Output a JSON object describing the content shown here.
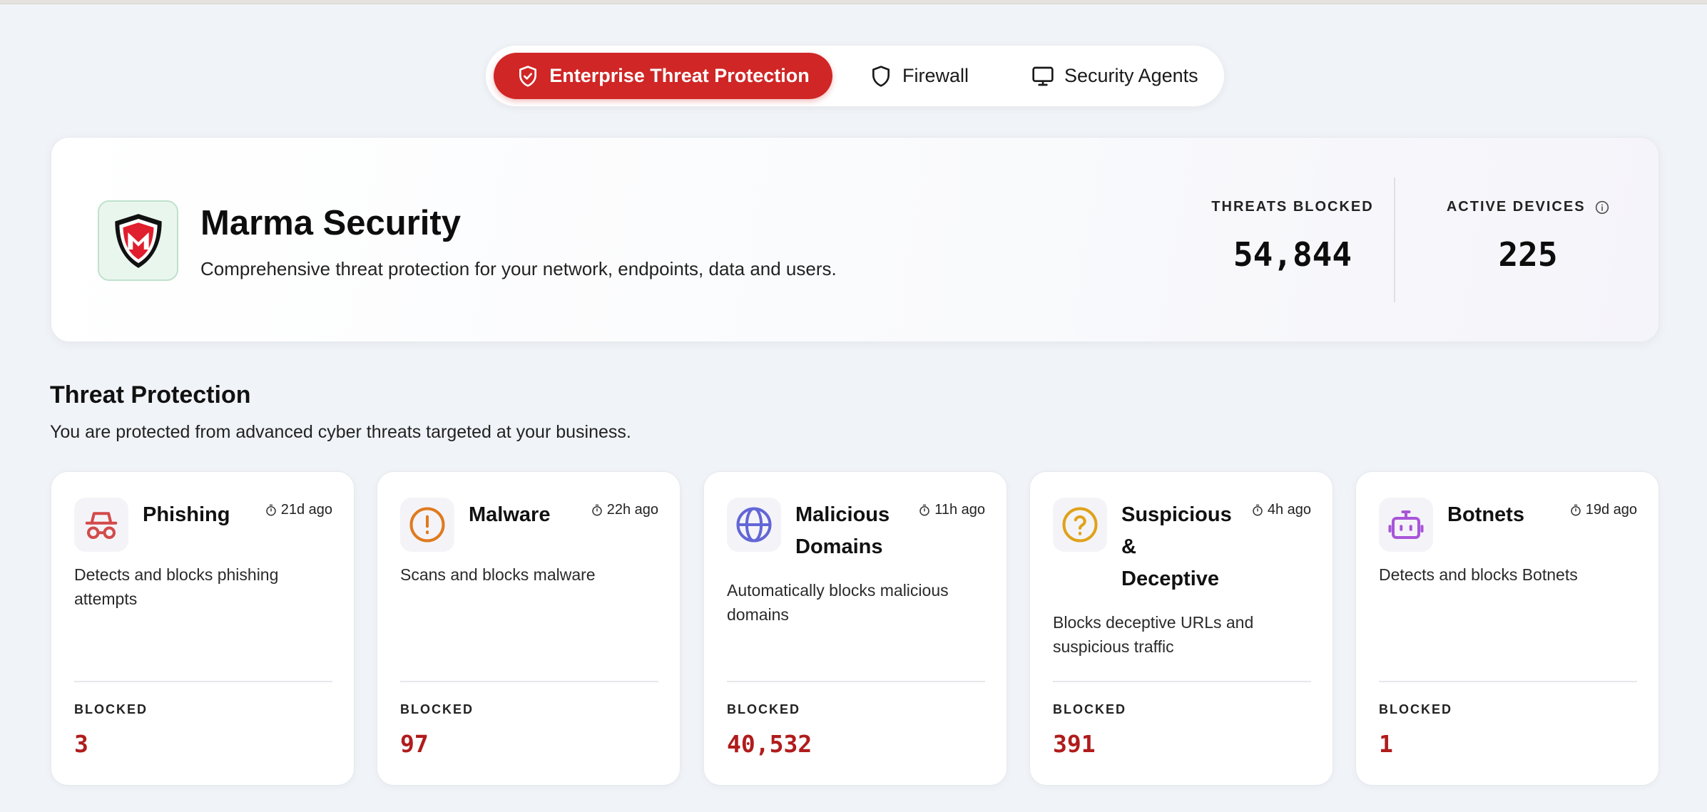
{
  "tabs": [
    {
      "label": "Enterprise Threat Protection",
      "icon": "shield-check-icon",
      "active": true
    },
    {
      "label": "Firewall",
      "icon": "shield-icon",
      "active": false
    },
    {
      "label": "Security Agents",
      "icon": "monitor-icon",
      "active": false
    }
  ],
  "hero": {
    "title": "Marma Security",
    "subtitle": "Comprehensive threat protection for your network, endpoints, data and users.",
    "logo_icon": "m-shield-logo",
    "stats": [
      {
        "label": "THREATS BLOCKED",
        "value": "54,844"
      },
      {
        "label": "ACTIVE DEVICES",
        "value": "225",
        "icon": "info-icon"
      }
    ]
  },
  "section": {
    "title": "Threat Protection",
    "subtitle": "You are protected from advanced cyber threats targeted at your business."
  },
  "cards": [
    {
      "title": "Phishing",
      "time": "21d ago",
      "description": "Detects and blocks phishing attempts",
      "blocked_label": "BLOCKED",
      "blocked_value": "3",
      "icon": "spy-icon",
      "icon_color": "#d34a4a"
    },
    {
      "title": "Malware",
      "time": "22h ago",
      "description": "Scans and blocks malware",
      "blocked_label": "BLOCKED",
      "blocked_value": "97",
      "icon": "alert-circle-icon",
      "icon_color": "#e07a1f"
    },
    {
      "title": "Malicious Domains",
      "time": "11h ago",
      "description": "Automatically blocks malicious domains",
      "blocked_label": "BLOCKED",
      "blocked_value": "40,532",
      "icon": "globe-icon",
      "icon_color": "#6366d6"
    },
    {
      "title": "Suspicious & Deceptive",
      "time": "4h ago",
      "description": "Blocks deceptive URLs and suspicious traffic",
      "blocked_label": "BLOCKED",
      "blocked_value": "391",
      "icon": "help-circle-icon",
      "icon_color": "#e0a21a"
    },
    {
      "title": "Botnets",
      "time": "19d ago",
      "description": "Detects and blocks Botnets",
      "blocked_label": "BLOCKED",
      "blocked_value": "1",
      "icon": "bot-icon",
      "icon_color": "#a855d8"
    }
  ],
  "colors": {
    "accent": "#d02626",
    "blocked_value": "#b01c1c",
    "background": "#f0f3f7"
  }
}
